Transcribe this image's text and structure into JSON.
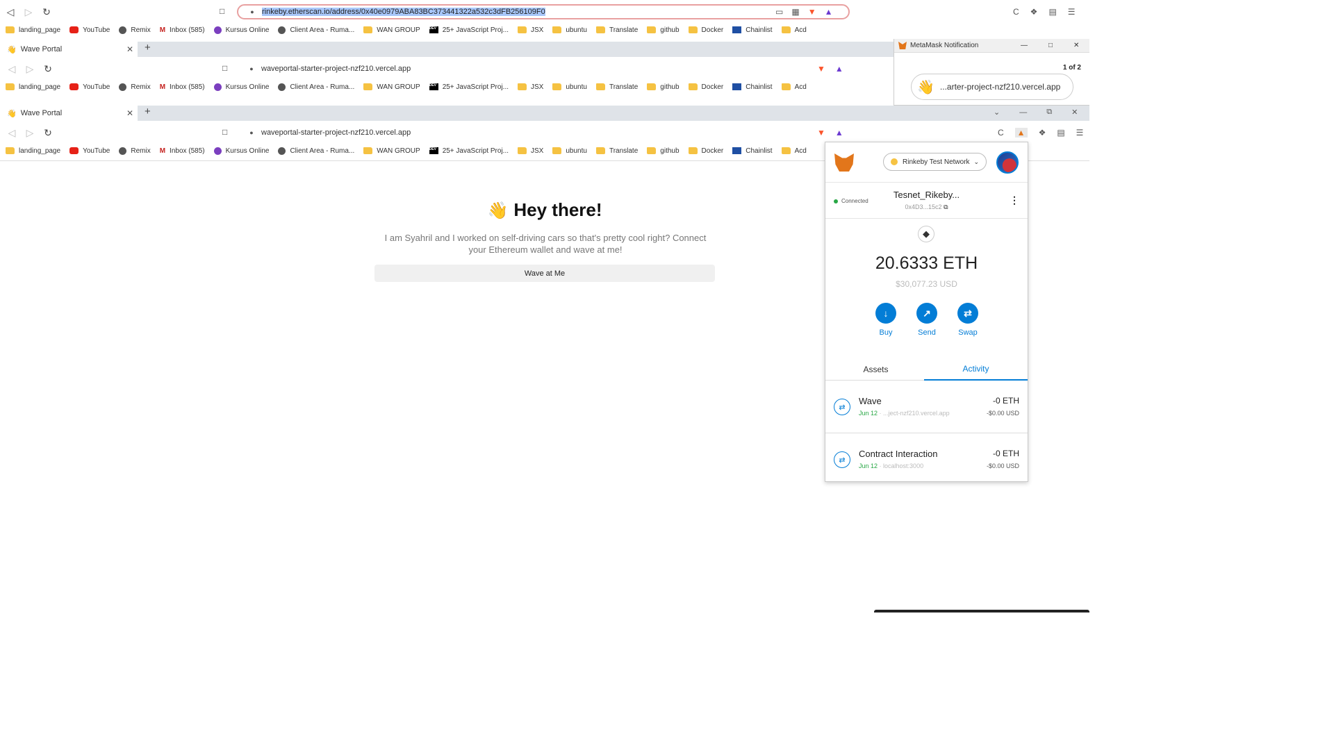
{
  "browser_top": {
    "url": "rinkeby.etherscan.io/address/0x40e0979ABA83BC373441322a532c3dFB256109F0"
  },
  "bookmarks": [
    {
      "label": "landing_page",
      "icon": "folder-icon"
    },
    {
      "label": "YouTube",
      "icon": "youtube-icon"
    },
    {
      "label": "Remix",
      "icon": "remix-icon"
    },
    {
      "label": "Inbox (585)",
      "icon": "gmail-icon"
    },
    {
      "label": "Kursus Online",
      "icon": "kursus-icon"
    },
    {
      "label": "Client Area - Ruma...",
      "icon": "globe-icon"
    },
    {
      "label": "WAN GROUP",
      "icon": "folder-icon"
    },
    {
      "label": "25+ JavaScript Proj...",
      "icon": "dev-icon"
    },
    {
      "label": "JSX",
      "icon": "folder-icon"
    },
    {
      "label": "ubuntu",
      "icon": "folder-icon"
    },
    {
      "label": "Translate",
      "icon": "folder-icon"
    },
    {
      "label": "github",
      "icon": "folder-icon"
    },
    {
      "label": "Docker",
      "icon": "folder-icon"
    },
    {
      "label": "Chainlist",
      "icon": "chainlist-icon"
    },
    {
      "label": "Acd",
      "icon": "folder-icon"
    }
  ],
  "tab": {
    "title": "Wave Portal"
  },
  "page_url": "waveportal-starter-project-nzf210.vercel.app",
  "notification": {
    "title": "MetaMask Notification",
    "counter": "1 of 2",
    "origin": "...arter-project-nzf210.vercel.app"
  },
  "page": {
    "title": "Hey there!",
    "description": "I am Syahril and I worked on self-driving cars so that's pretty cool right? Connect your Ethereum wallet and wave at me!",
    "button": "Wave at Me"
  },
  "metamask": {
    "network": "Rinkeby Test Network",
    "connected": "Connected",
    "account_name": "Tesnet_Rikeby...",
    "account_address": "0x4D3...15c2",
    "balance": "20.6333 ETH",
    "balance_usd": "$30,077.23 USD",
    "actions": [
      "Buy",
      "Send",
      "Swap"
    ],
    "tabs": [
      "Assets",
      "Activity"
    ],
    "active_tab": "Activity",
    "transactions": [
      {
        "title": "Wave",
        "date": "Jun 12",
        "origin": "...ject-nzf210.vercel.app",
        "amount": "-0 ETH",
        "usd": "-$0.00 USD"
      },
      {
        "title": "Contract Interaction",
        "date": "Jun 12",
        "origin": "localhost:3000",
        "amount": "-0 ETH",
        "usd": "-$0.00 USD"
      }
    ],
    "accent": "#037dd6"
  }
}
